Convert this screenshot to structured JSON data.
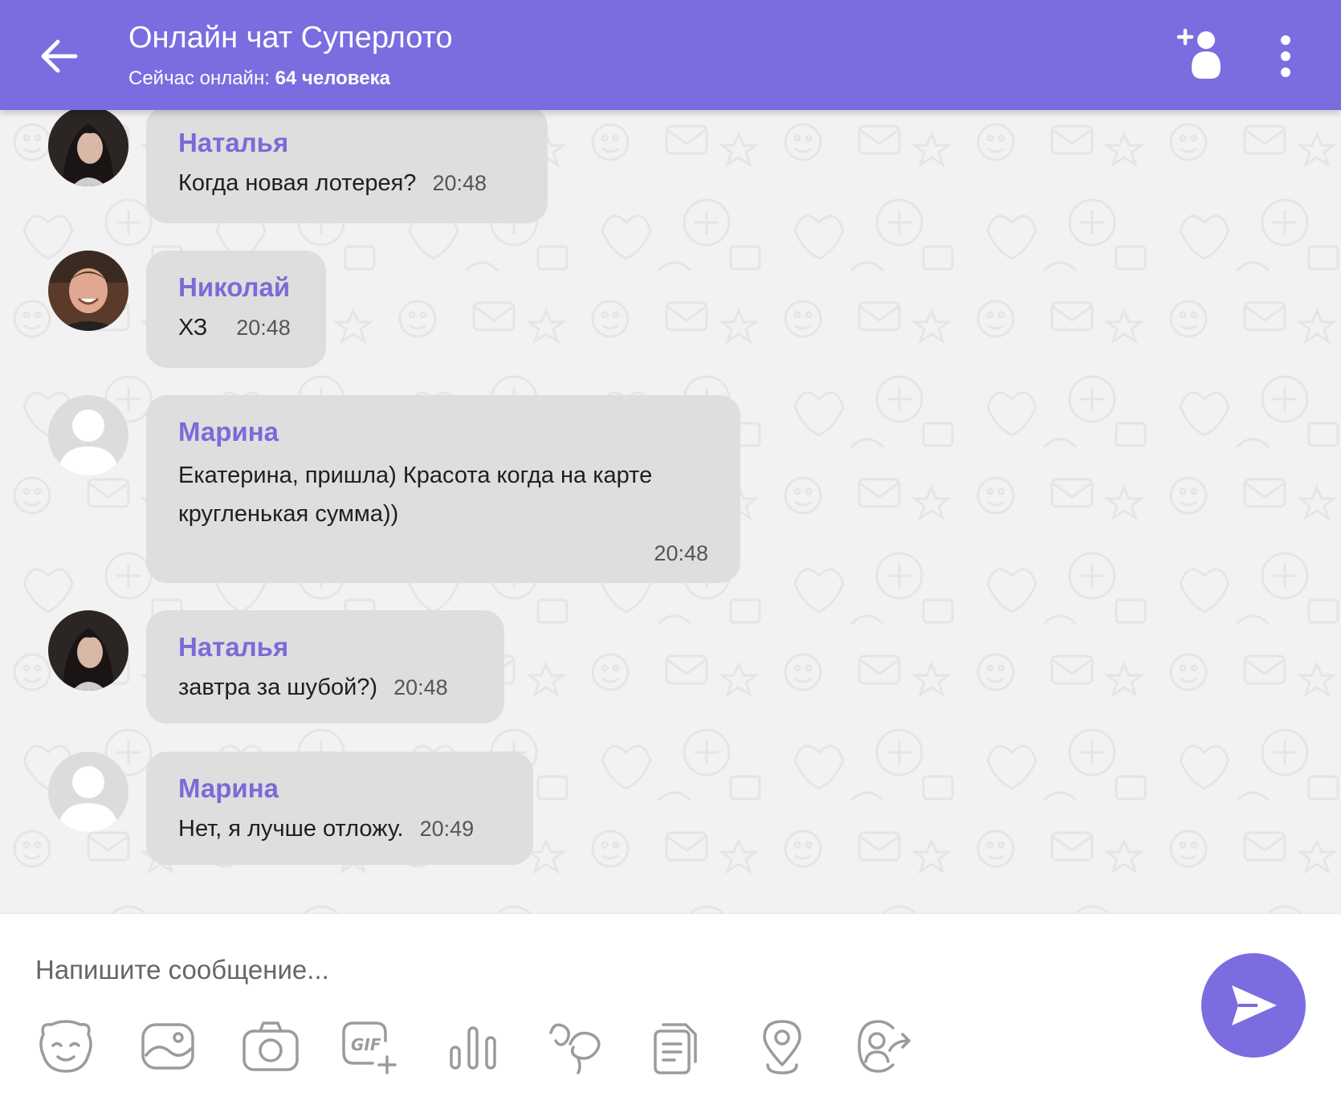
{
  "header": {
    "title": "Онлайн чат Суперлото",
    "online_label": "Сейчас онлайн:",
    "online_count": "64 человека",
    "color": "#7b6ce0"
  },
  "messages": [
    {
      "sender": "Наталья",
      "text": "Когда новая лотерея?",
      "time": "20:48",
      "avatar": "photo-woman"
    },
    {
      "sender": "Николай",
      "text": "ХЗ",
      "time": "20:48",
      "avatar": "photo-man"
    },
    {
      "sender": "Марина",
      "text_line1": "Екатерина, пришла) Красота когда на карте",
      "text_line2": "кругленькая сумма))",
      "time": "20:48",
      "avatar": "default-user-icon"
    },
    {
      "sender": "Наталья",
      "text": "завтра за шубой?)",
      "time": "20:48",
      "avatar": "photo-woman"
    },
    {
      "sender": "Марина",
      "text": "Нет, я лучше отложу.",
      "time": "20:49",
      "avatar": "default-user-icon"
    }
  ],
  "composer": {
    "placeholder": "Напишите сообщение...",
    "gif_label": "GIF",
    "tools": [
      "sticker-icon",
      "image-icon",
      "camera-icon",
      "gif-icon",
      "poll-icon",
      "doodle-icon",
      "file-icon",
      "location-icon",
      "share-contact-icon"
    ]
  },
  "colors": {
    "accent": "#7b6ce0",
    "sender_name": "#7a6bd8",
    "bubble": "#dedede",
    "chat_bg": "#f3f2f2"
  }
}
